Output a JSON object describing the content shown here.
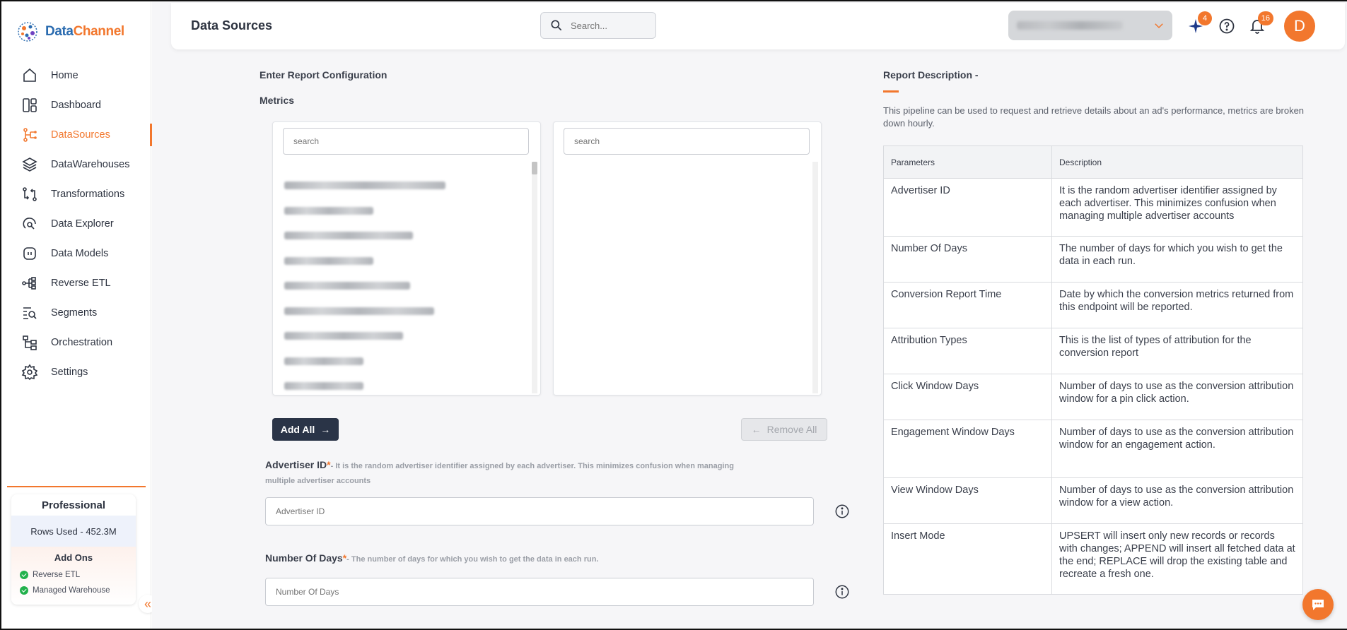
{
  "brand": {
    "name_part1": "Data",
    "name_part2": "Channel"
  },
  "header": {
    "title": "Data Sources",
    "search_placeholder": "Search...",
    "sparkle_badge": "4",
    "notification_badge": "16",
    "avatar_initial": "D"
  },
  "sidebar": {
    "items": [
      {
        "label": "Home",
        "icon": "home-icon"
      },
      {
        "label": "Dashboard",
        "icon": "dashboard-icon"
      },
      {
        "label": "DataSources",
        "icon": "datasources-icon",
        "active": true
      },
      {
        "label": "DataWarehouses",
        "icon": "datawarehouses-icon"
      },
      {
        "label": "Transformations",
        "icon": "transformations-icon"
      },
      {
        "label": "Data Explorer",
        "icon": "data-explorer-icon"
      },
      {
        "label": "Data Models",
        "icon": "data-models-icon"
      },
      {
        "label": "Reverse ETL",
        "icon": "reverse-etl-icon"
      },
      {
        "label": "Segments",
        "icon": "segments-icon"
      },
      {
        "label": "Orchestration",
        "icon": "orchestration-icon"
      },
      {
        "label": "Settings",
        "icon": "settings-icon"
      }
    ],
    "plan": {
      "name": "Professional",
      "rows_used": "Rows Used - 452.3M",
      "addons_title": "Add Ons",
      "addons": [
        "Reverse ETL",
        "Managed Warehouse"
      ]
    }
  },
  "form": {
    "section_title": "Enter Report Configuration",
    "metrics_label": "Metrics",
    "left_search_placeholder": "search",
    "right_search_placeholder": "search",
    "add_all_label": "Add All",
    "remove_all_label": "Remove All",
    "advertiser": {
      "label": "Advertiser ID",
      "required": "*",
      "hint": "- It is the random advertiser identifier assigned by each advertiser. This minimizes confusion when managing multiple advertiser accounts",
      "placeholder": "Advertiser ID"
    },
    "days": {
      "label": "Number Of Days",
      "required": "*",
      "hint": "- The number of days for which you wish to get the data in each run.",
      "placeholder": "Number Of Days"
    }
  },
  "description": {
    "title": "Report Description -",
    "text": "This pipeline can be used to request and retrieve details about an ad's performance, metrics are broken down hourly.",
    "headers": [
      "Parameters",
      "Description"
    ],
    "rows": [
      {
        "param": "Advertiser ID",
        "desc": "It is the random advertiser identifier assigned by each advertiser. This minimizes confusion when managing multiple advertiser accounts"
      },
      {
        "param": "Number Of Days",
        "desc": "The number of days for which you wish to get the data in each run."
      },
      {
        "param": "Conversion Report Time",
        "desc": "Date by which the conversion metrics returned from this endpoint will be reported."
      },
      {
        "param": "Attribution Types",
        "desc": "This is the list of types of attribution for the conversion report"
      },
      {
        "param": "Click Window Days",
        "desc": "Number of days to use as the conversion attribution window for a pin click action."
      },
      {
        "param": "Engagement Window Days",
        "desc": "Number of days to use as the conversion attribution window for an engagement action."
      },
      {
        "param": "View Window Days",
        "desc": "Number of days to use as the conversion attribution window for a view action."
      },
      {
        "param": "Insert Mode",
        "desc": "UPSERT will insert only new records or records with changes; APPEND will insert all fetched data at the end; REPLACE will drop the existing table and recreate a fresh one."
      }
    ]
  },
  "colors": {
    "accent": "#f2772d",
    "dark_button": "#2a3447"
  }
}
